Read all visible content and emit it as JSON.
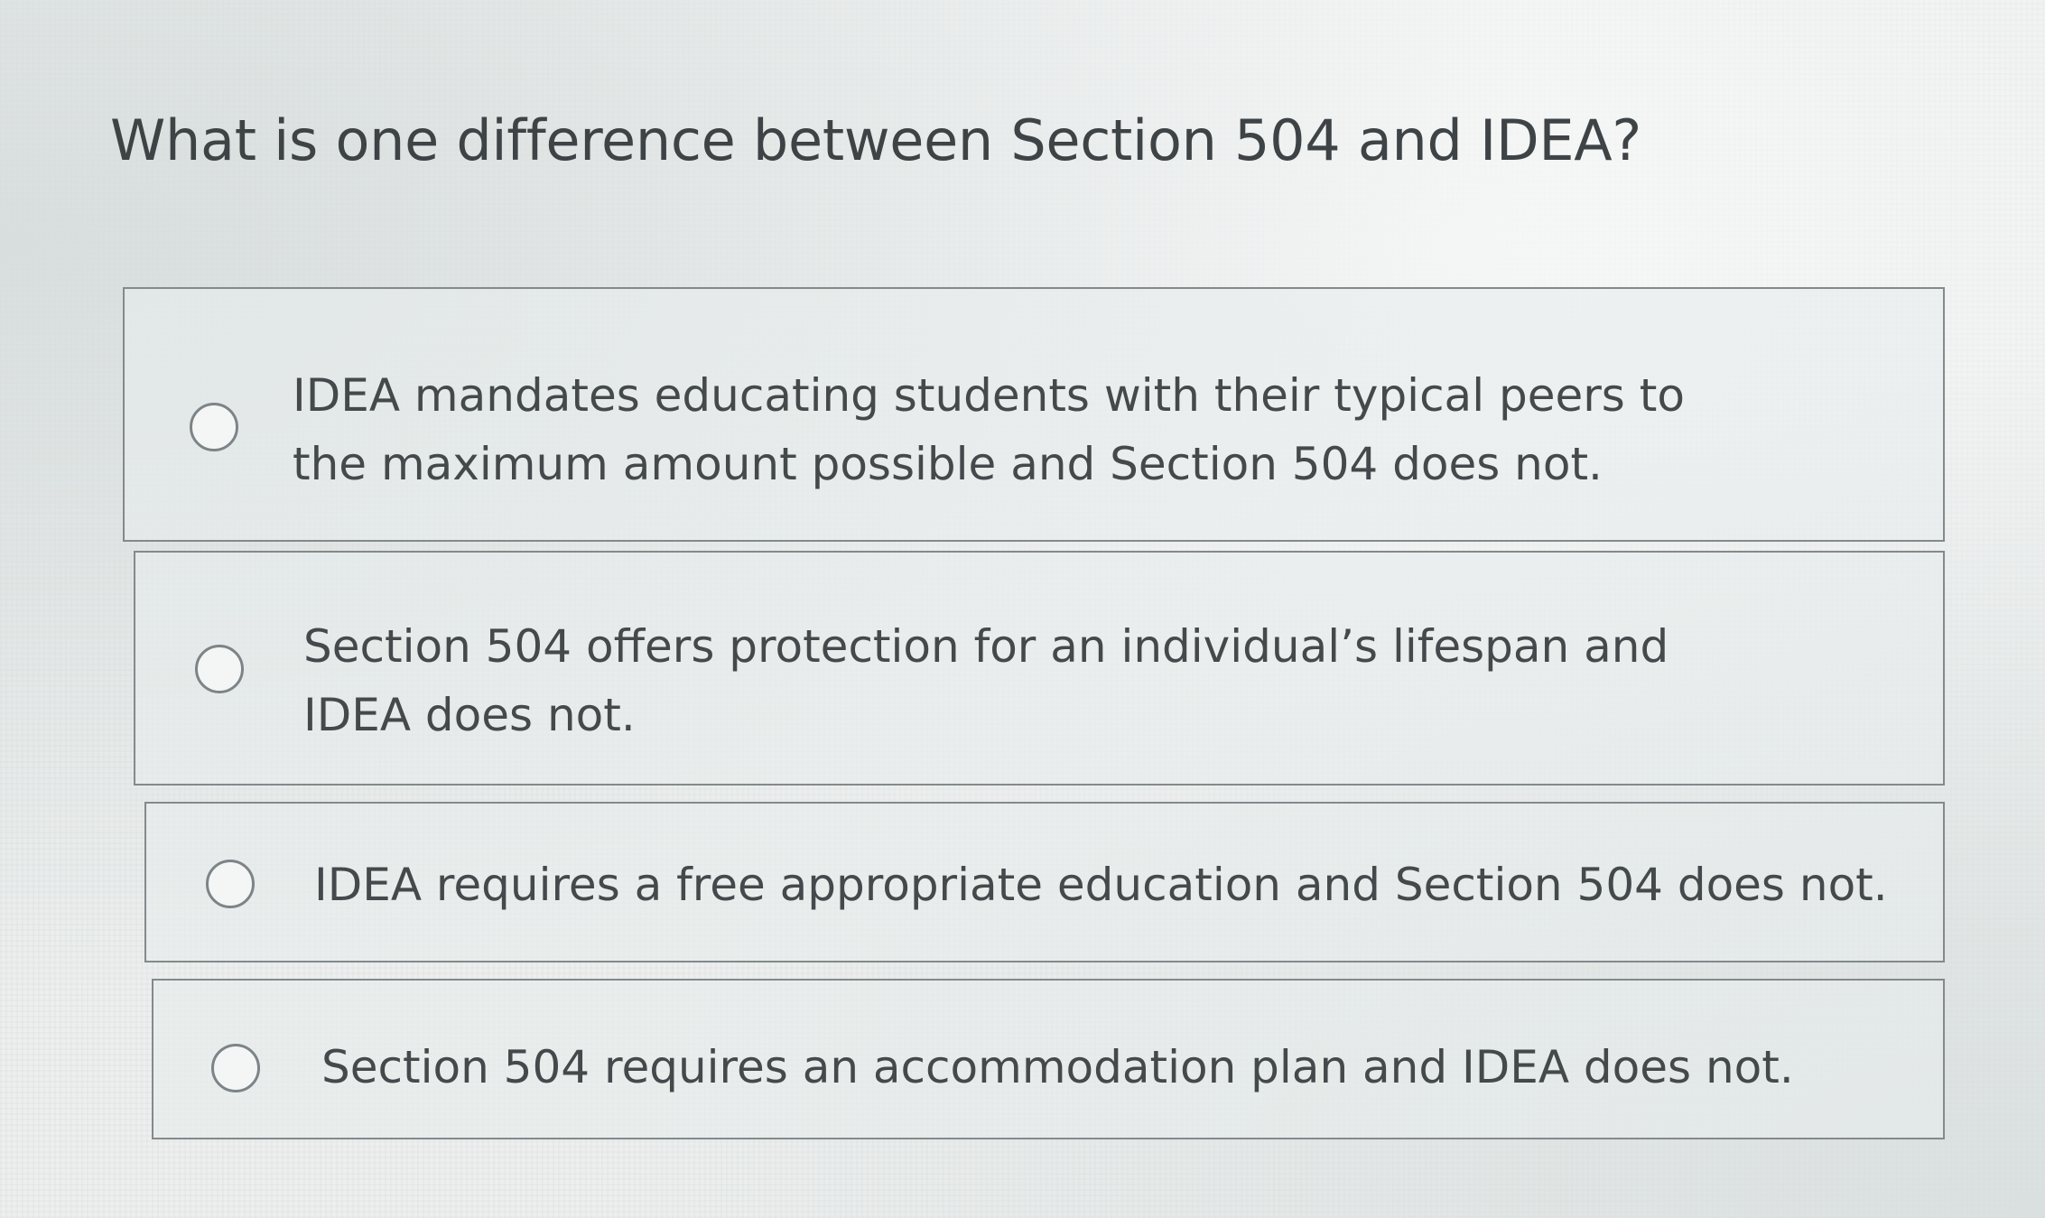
{
  "question": {
    "text": "What is one difference between Section 504 and IDEA?"
  },
  "options": [
    {
      "label": "IDEA mandates educating students with their typical peers to the maximum amount possible and Section 504 does not.",
      "selected": false
    },
    {
      "label": "Section 504 offers protection for an individual’s lifespan and IDEA does not.",
      "selected": false
    },
    {
      "label": "IDEA requires a free appropriate education and Section 504 does not.",
      "selected": false
    },
    {
      "label": "Section 504 requires an accommodation plan and IDEA does not.",
      "selected": false
    }
  ],
  "colors": {
    "text": "#3e4346",
    "border": "#838a8c",
    "background": "#ecefee"
  }
}
